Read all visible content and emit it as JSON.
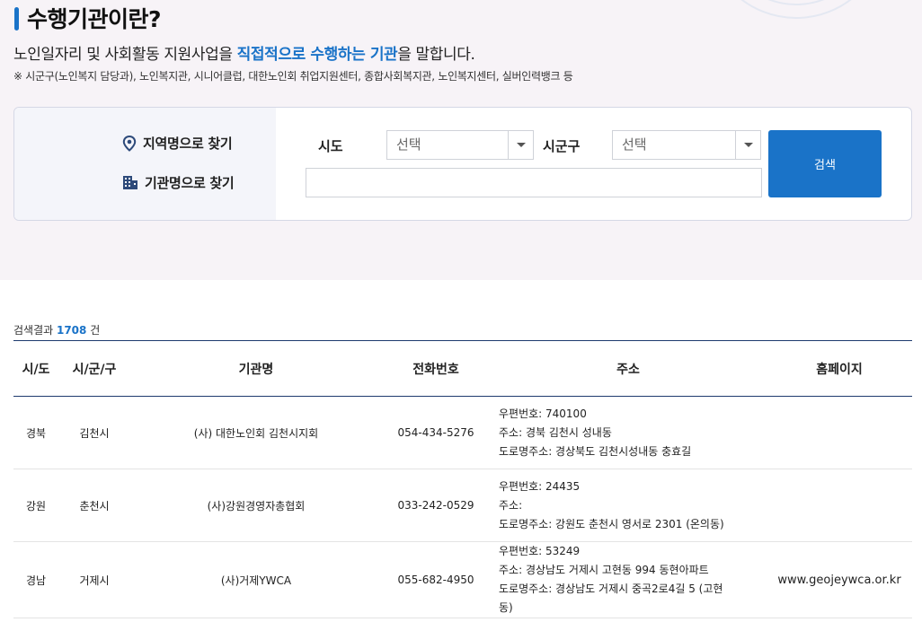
{
  "header": {
    "title": "수행기관이란?",
    "desc_before": "노인일자리 및 사회활동 지원사업을 ",
    "desc_highlight": "직접적으로 수행하는 기관",
    "desc_after": "을 말합니다.",
    "note": "※ 시군구(노인복지 담당과), 노인복지관, 시니어클럽, 대한노인회 취업지원센터, 종합사회복지관, 노인복지센터, 실버인력뱅크 등"
  },
  "search": {
    "tab_region": "지역명으로 찾기",
    "tab_name": "기관명으로 찾기",
    "sido_label": "시도",
    "sido_value": "선택",
    "sigungu_label": "시군구",
    "sigungu_value": "선택",
    "name_value": "",
    "button_label": "검색"
  },
  "results": {
    "prefix": "검색결과 ",
    "count": "1708",
    "suffix": " 건"
  },
  "table": {
    "headers": [
      "시/도",
      "시/군/구",
      "기관명",
      "전화번호",
      "주소",
      "홈페이지"
    ],
    "rows": [
      {
        "sido": "경북",
        "sigungu": "김천시",
        "name": "(사) 대한노인회 김천시지회",
        "phone": "054-434-5276",
        "zip": "우편번호:  740100",
        "addr": "주소:  경북 김천시 성내동",
        "road": "도로명주소:  경상북도 김천시성내동 충효길",
        "road2": "",
        "home": ""
      },
      {
        "sido": "강원",
        "sigungu": "춘천시",
        "name": "(사)강원경영자총협회",
        "phone": "033-242-0529",
        "zip": "우편번호:  24435",
        "addr": "주소:",
        "road": "도로명주소:  강원도 춘천시 영서로 2301 (온의동)",
        "road2": "",
        "home": ""
      },
      {
        "sido": "경남",
        "sigungu": "거제시",
        "name": "(사)거제YWCA",
        "phone": "055-682-4950",
        "zip": "우편번호:  53249",
        "addr": "주소:  경상남도 거제시 고현동 994 동현아파트",
        "road": "도로명주소:  경상남도 거제시 중곡2로4길 5 (고현",
        "road2": "동)",
        "home": "www.geojeywca.or.kr"
      }
    ]
  },
  "colors": {
    "accent": "#1a73c8",
    "top_bg": "#f7f3f7",
    "header_line": "#1e3a6e"
  },
  "icons": {
    "region": "map-pin-icon",
    "name": "building-icon",
    "dropdown": "chevron-down-icon"
  }
}
